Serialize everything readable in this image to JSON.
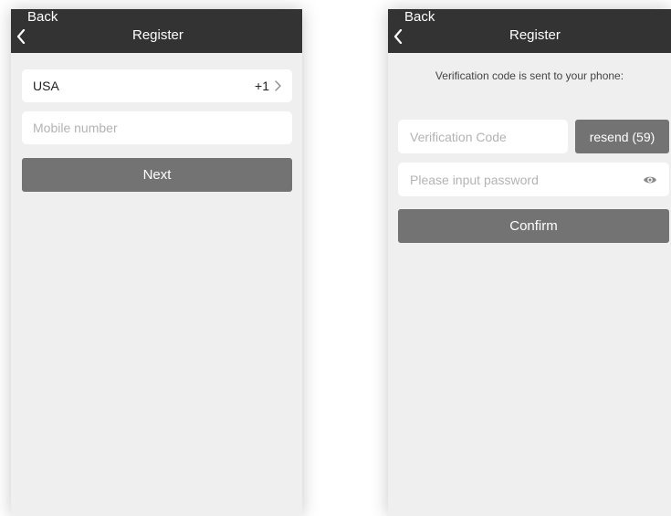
{
  "screen_left": {
    "nav": {
      "back_label": "Back",
      "title": "Register"
    },
    "country": {
      "name": "USA",
      "code": "+1"
    },
    "mobile": {
      "placeholder": "Mobile number"
    },
    "next_label": "Next"
  },
  "screen_right": {
    "nav": {
      "back_label": "Back",
      "title": "Register"
    },
    "info_text": "Verification code is sent to your phone:",
    "verification": {
      "placeholder": "Verification Code"
    },
    "resend_label": "resend (59)",
    "password": {
      "placeholder": "Please input password"
    },
    "confirm_label": "Confirm"
  },
  "colors": {
    "navbar_bg": "#333333",
    "screen_bg": "#eeefee",
    "button_bg": "#737373",
    "placeholder_text": "#b3b3b3"
  },
  "icons": {
    "back": "chevron-left-icon",
    "country_arrow": "chevron-right-icon",
    "password_toggle": "eye-icon"
  }
}
